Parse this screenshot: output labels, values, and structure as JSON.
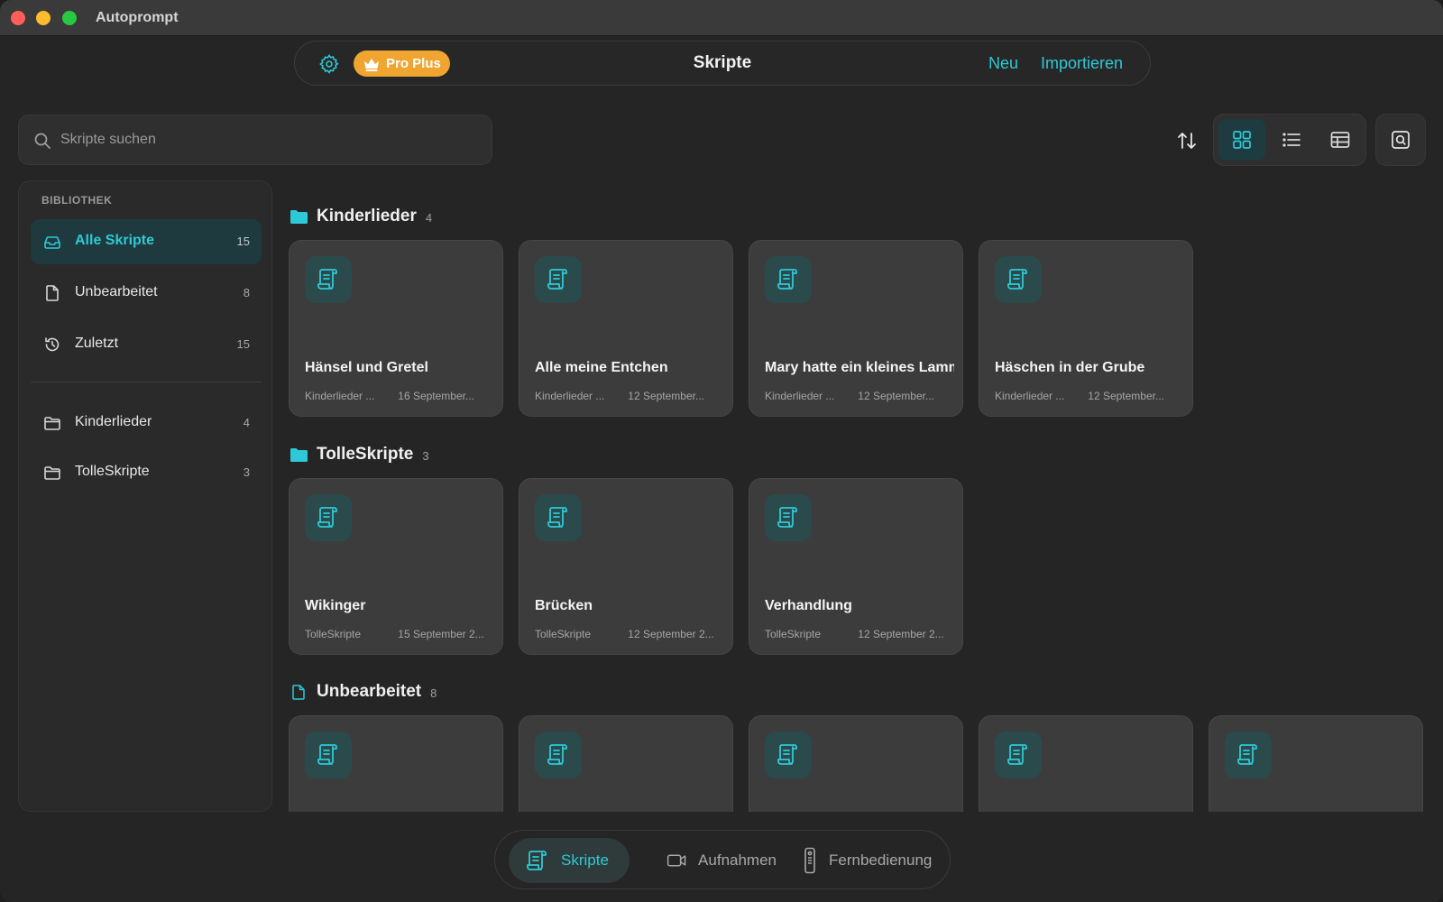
{
  "window": {
    "title": "Autoprompt"
  },
  "toolbar": {
    "badge_label": "Pro Plus",
    "title": "Skripte",
    "new_label": "Neu",
    "import_label": "Importieren"
  },
  "search": {
    "placeholder": "Skripte suchen"
  },
  "sidebar": {
    "heading": "BIBLIOTHEK",
    "items": [
      {
        "label": "Alle Skripte",
        "count": "15",
        "icon": "inbox-icon",
        "active": true
      },
      {
        "label": "Unbearbeitet",
        "count": "8",
        "icon": "document-icon"
      },
      {
        "label": "Zuletzt",
        "count": "15",
        "icon": "history-icon"
      }
    ],
    "folders": [
      {
        "label": "Kinderlieder",
        "count": "4",
        "icon": "folder-icon"
      },
      {
        "label": "TolleSkripte",
        "count": "3",
        "icon": "folder-icon"
      }
    ]
  },
  "sections": [
    {
      "title": "Kinderlieder",
      "count": "4",
      "icon": "folder-filled-icon",
      "cards": [
        {
          "title": "Hänsel und Gretel",
          "folder": "Kinderlieder ...",
          "date": "16 September..."
        },
        {
          "title": "Alle meine Entchen",
          "folder": "Kinderlieder ...",
          "date": "12 September..."
        },
        {
          "title": "Mary hatte ein kleines Lamm",
          "folder": "Kinderlieder ...",
          "date": "12 September..."
        },
        {
          "title": "Häschen in der Grube",
          "folder": "Kinderlieder ...",
          "date": "12 September..."
        }
      ]
    },
    {
      "title": "TolleSkripte",
      "count": "3",
      "icon": "folder-filled-icon",
      "cards": [
        {
          "title": "Wikinger",
          "folder": "TolleSkripte",
          "date": "15 September 2..."
        },
        {
          "title": "Brücken",
          "folder": "TolleSkripte",
          "date": "12 September 2..."
        },
        {
          "title": "Verhandlung",
          "folder": "TolleSkripte",
          "date": "12 September 2..."
        }
      ]
    },
    {
      "title": "Unbearbeitet",
      "count": "8",
      "icon": "document-icon",
      "cards": [
        {},
        {},
        {},
        {},
        {}
      ]
    }
  ],
  "tabs": [
    {
      "label": "Skripte",
      "icon": "script-icon",
      "active": true
    },
    {
      "label": "Aufnahmen",
      "icon": "video-camera-icon"
    },
    {
      "label": "Fernbedienung",
      "icon": "remote-icon"
    }
  ],
  "colors": {
    "accent": "#2ec9d6",
    "badge": "#f0a531",
    "background": "#252525",
    "card": "#3c3c3c"
  }
}
